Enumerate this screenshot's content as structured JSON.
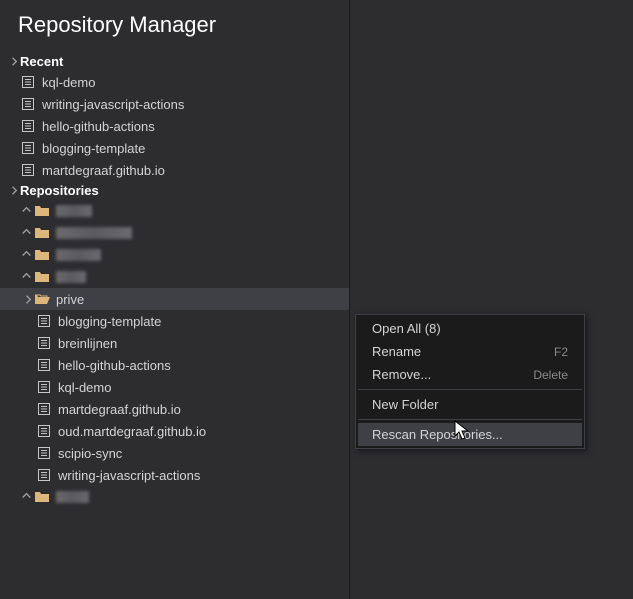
{
  "title": "Repository Manager",
  "sections": {
    "recent": {
      "label": "Recent",
      "items": [
        {
          "label": "kql-demo"
        },
        {
          "label": "writing-javascript-actions"
        },
        {
          "label": "hello-github-actions"
        },
        {
          "label": "blogging-template"
        },
        {
          "label": "martdegraaf.github.io"
        }
      ]
    },
    "repositories": {
      "label": "Repositories",
      "folders_blurred_count": 4,
      "open_folder": {
        "label": "prive",
        "children": [
          {
            "label": "blogging-template"
          },
          {
            "label": "breinlijnen"
          },
          {
            "label": "hello-github-actions"
          },
          {
            "label": "kql-demo"
          },
          {
            "label": "martdegraaf.github.io"
          },
          {
            "label": "oud.martdegraaf.github.io"
          },
          {
            "label": "scipio-sync"
          },
          {
            "label": "writing-javascript-actions"
          }
        ]
      },
      "trailing_blurred_folders": 1
    }
  },
  "context_menu": {
    "items": [
      {
        "label": "Open All (8)",
        "shortcut": ""
      },
      {
        "label": "Rename",
        "shortcut": "F2"
      },
      {
        "label": "Remove...",
        "shortcut": "Delete"
      },
      {
        "sep": true
      },
      {
        "label": "New Folder",
        "shortcut": ""
      },
      {
        "sep": true
      },
      {
        "label": "Rescan Repositories...",
        "shortcut": "",
        "hovered": true
      }
    ]
  },
  "colors": {
    "bg": "#2d2d30",
    "folder": "#dcb67a",
    "text": "#d4d4d4"
  }
}
